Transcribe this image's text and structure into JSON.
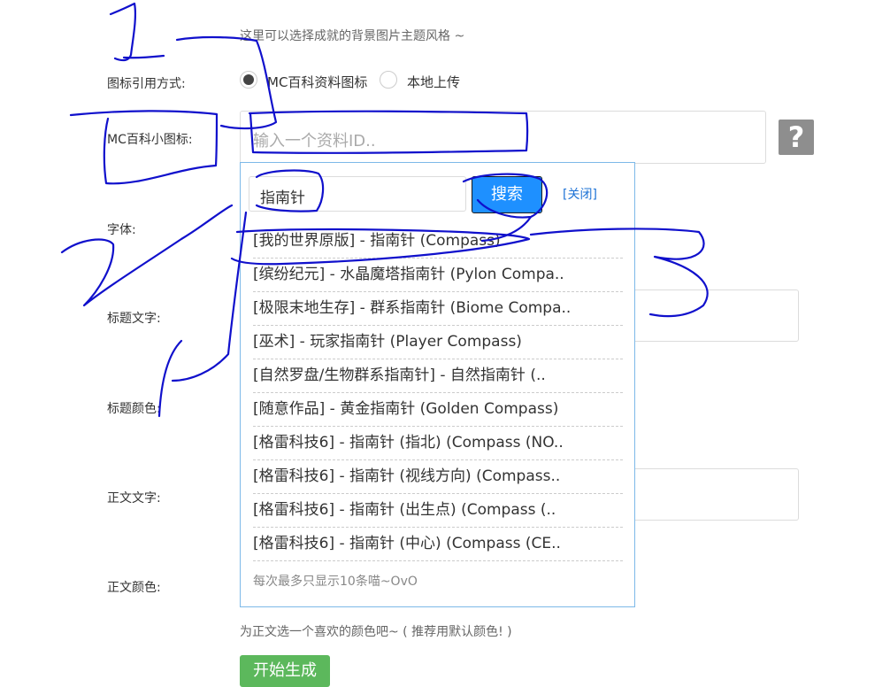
{
  "top_hint": "这里可以选择成就的背景图片主题风格 ~",
  "icon_source": {
    "label": "图标引用方式:",
    "options": [
      {
        "label": "MC百科资料图标",
        "selected": true
      },
      {
        "label": "本地上传",
        "selected": false
      }
    ]
  },
  "small_icon": {
    "label": "MC百科小图标:",
    "placeholder": "输入一个资料ID..",
    "help": "?"
  },
  "form_labels": {
    "font": "字体:",
    "title_text": "标题文字:",
    "title_color": "标题颜色:",
    "body_text": "正文文字:",
    "body_color": "正文颜色:"
  },
  "search_popup": {
    "query": "指南针",
    "search_button": "搜索",
    "close_link": "[关闭]",
    "results": [
      "[我的世界原版] - 指南针 (Compass)",
      "[缤纷纪元] - 水晶魔塔指南针 (Pylon Compa..",
      "[极限末地生存] - 群系指南针 (Biome Compa..",
      "[巫术] - 玩家指南针 (Player Compass)",
      "[自然罗盘/生物群系指南针] - 自然指南针 (..",
      "[随意作品] - 黄金指南针 (Golden Compass)",
      "[格雷科技6] - 指南针 (指北) (Compass (NO..",
      "[格雷科技6] - 指南针 (视线方向) (Compass..",
      "[格雷科技6] - 指南针 (出生点) (Compass (..",
      "[格雷科技6] - 指南针 (中心) (Compass (CE.."
    ],
    "footer": "每次最多只显示10条喵~OvO"
  },
  "body_color_hint": "为正文选一个喜欢的颜色吧~ ( 推荐用默认颜色! )",
  "start_button": "开始生成",
  "colors": {
    "accent": "#1e90ff",
    "ink": "#1010cc",
    "popup_border": "#7db9e8",
    "start": "#5cb85c"
  }
}
